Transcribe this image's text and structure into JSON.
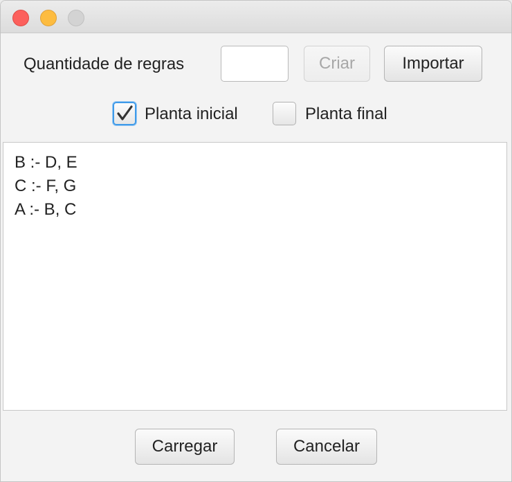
{
  "window": {
    "controls": [
      "close",
      "minimize",
      "zoom"
    ]
  },
  "rules_form": {
    "quantity_label": "Quantidade de regras",
    "quantity_value": "",
    "create_button": "Criar",
    "create_disabled": true,
    "import_button": "Importar"
  },
  "options": {
    "initial_plant_label": "Planta inicial",
    "initial_plant_checked": true,
    "final_plant_label": "Planta final",
    "final_plant_checked": false
  },
  "rules_text": {
    "lines": [
      "B :- D, E",
      "C :- F, G",
      "A :- B, C"
    ]
  },
  "footer": {
    "load_button": "Carregar",
    "cancel_button": "Cancelar"
  },
  "colors": {
    "close": "#fc605c",
    "minimize": "#fdbc40",
    "zoom": "#d3d3d3",
    "focus_accent": "#3e9ae9"
  }
}
